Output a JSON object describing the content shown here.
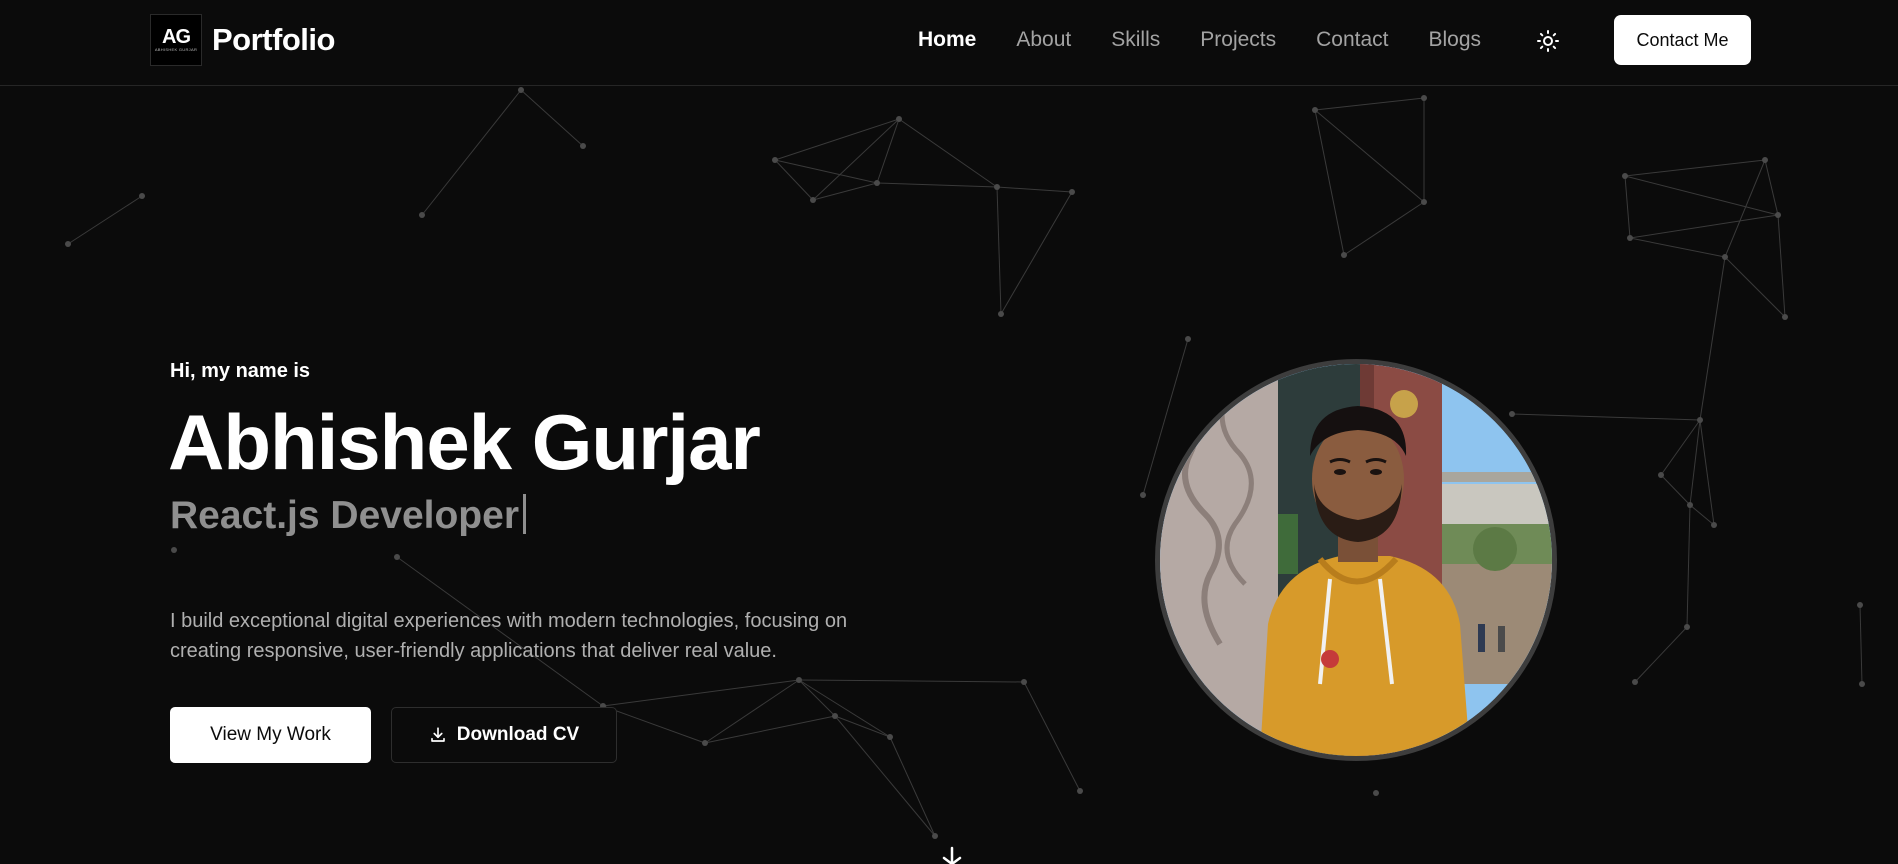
{
  "brand": {
    "logo_mark": "AG",
    "logo_sub": "ABHISHEK GURJAR",
    "title": "Portfolio"
  },
  "nav": {
    "items": [
      {
        "label": "Home",
        "active": true
      },
      {
        "label": "About",
        "active": false
      },
      {
        "label": "Skills",
        "active": false
      },
      {
        "label": "Projects",
        "active": false
      },
      {
        "label": "Contact",
        "active": false
      },
      {
        "label": "Blogs",
        "active": false
      }
    ],
    "theme_icon": "sun-icon",
    "cta_label": "Contact Me"
  },
  "hero": {
    "greeting": "Hi, my name is",
    "name": "Abhishek Gurjar",
    "role": "React.js Developer",
    "description": "I build exceptional digital experiences with modern technologies, focusing on creating responsive, user-friendly applications that deliver real value.",
    "primary_button": "View My Work",
    "secondary_button": "Download CV",
    "secondary_icon": "download-icon",
    "scroll_icon": "arrow-down-icon"
  },
  "colors": {
    "background": "#0b0b0b",
    "text": "#ffffff",
    "muted": "#a3a3a3",
    "role_text": "#8f8f8f",
    "button_bg": "#ffffff",
    "avatar_border": "#3d3d3d",
    "network_line": "#3a3a3a"
  }
}
